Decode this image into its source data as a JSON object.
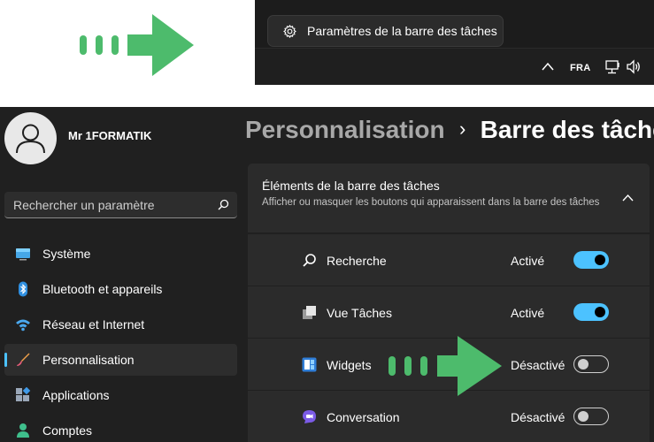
{
  "taskbar": {
    "context_menu_label": "Paramètres de la barre des tâches",
    "language": "FRA"
  },
  "settings": {
    "user_name": "Mr 1FORMATIK",
    "search_placeholder": "Rechercher un paramètre",
    "nav": [
      {
        "label": "Système",
        "icon": "monitor-icon"
      },
      {
        "label": "Bluetooth et appareils",
        "icon": "bluetooth-icon"
      },
      {
        "label": "Réseau et Internet",
        "icon": "wifi-icon"
      },
      {
        "label": "Personnalisation",
        "icon": "brush-icon",
        "active": true
      },
      {
        "label": "Applications",
        "icon": "apps-icon"
      },
      {
        "label": "Comptes",
        "icon": "account-icon"
      }
    ],
    "breadcrumb": {
      "parent": "Personnalisation",
      "separator": "›",
      "current": "Barre des tâches"
    },
    "group": {
      "title": "Éléments de la barre des tâches",
      "description": "Afficher ou masquer les boutons qui apparaissent dans la barre des tâches"
    },
    "items": [
      {
        "label": "Recherche",
        "state": "Activé",
        "on": true,
        "icon": "search-icon"
      },
      {
        "label": "Vue Tâches",
        "state": "Activé",
        "on": true,
        "icon": "task-view-icon"
      },
      {
        "label": "Widgets",
        "state": "Désactivé",
        "on": false,
        "icon": "widgets-icon"
      },
      {
        "label": "Conversation",
        "state": "Désactivé",
        "on": false,
        "icon": "chat-icon"
      }
    ]
  },
  "colors": {
    "accent": "#4cc2ff",
    "annotation_arrow": "#4dbb6c",
    "background": "#202020",
    "card": "#2b2b2b"
  }
}
